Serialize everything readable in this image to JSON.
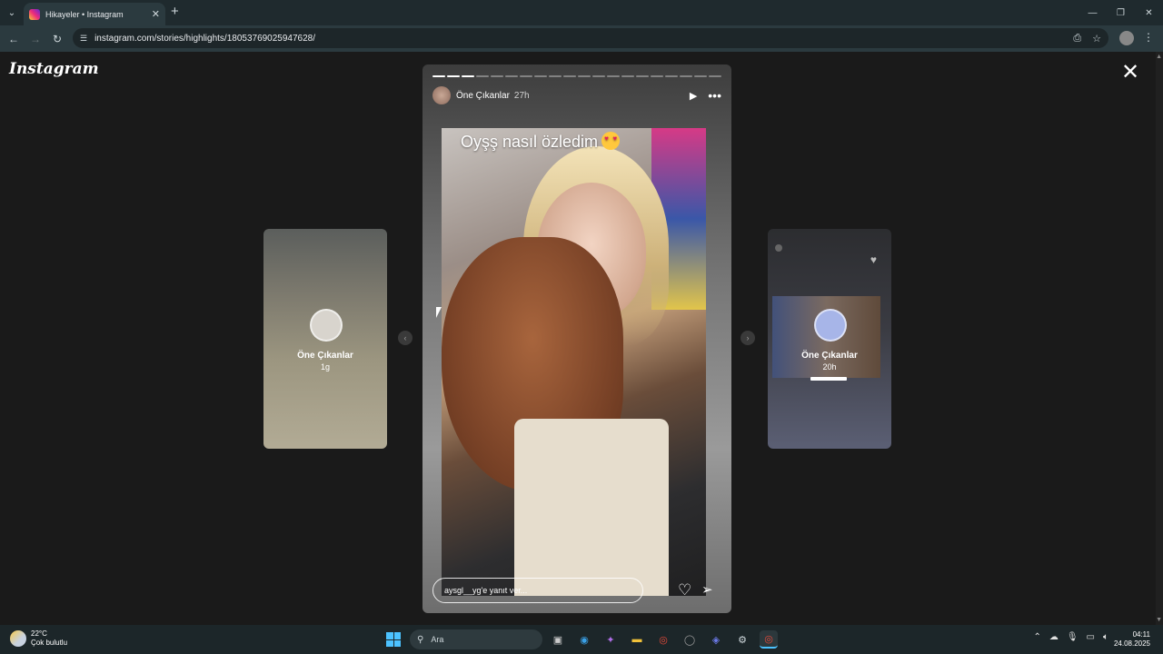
{
  "browser": {
    "tab_title": "Hikayeler • Instagram",
    "url": "instagram.com/stories/highlights/18053769025947628/"
  },
  "page": {
    "logo": "Instagram",
    "left_preview": {
      "name": "Öne Çıkanlar",
      "time": "1g"
    },
    "right_preview": {
      "name": "Öne Çıkanlar",
      "time": "20h"
    },
    "story": {
      "progress_total": 20,
      "progress_done": 3,
      "username": "Öne Çıkanlar",
      "time": "27h",
      "caption": "Oyşş nasıl özledim",
      "reply_placeholder": "aysgl__yg'e yanıt ver..."
    }
  },
  "taskbar": {
    "weather_temp": "22°C",
    "weather_desc": "Çok bulutlu",
    "search_placeholder": "Ara",
    "time": "04:11",
    "date": "24.08.2025"
  },
  "icons": {
    "close": "close-icon",
    "play": "play-icon",
    "more": "more-icon",
    "like": "heart-icon",
    "share": "send-icon"
  }
}
